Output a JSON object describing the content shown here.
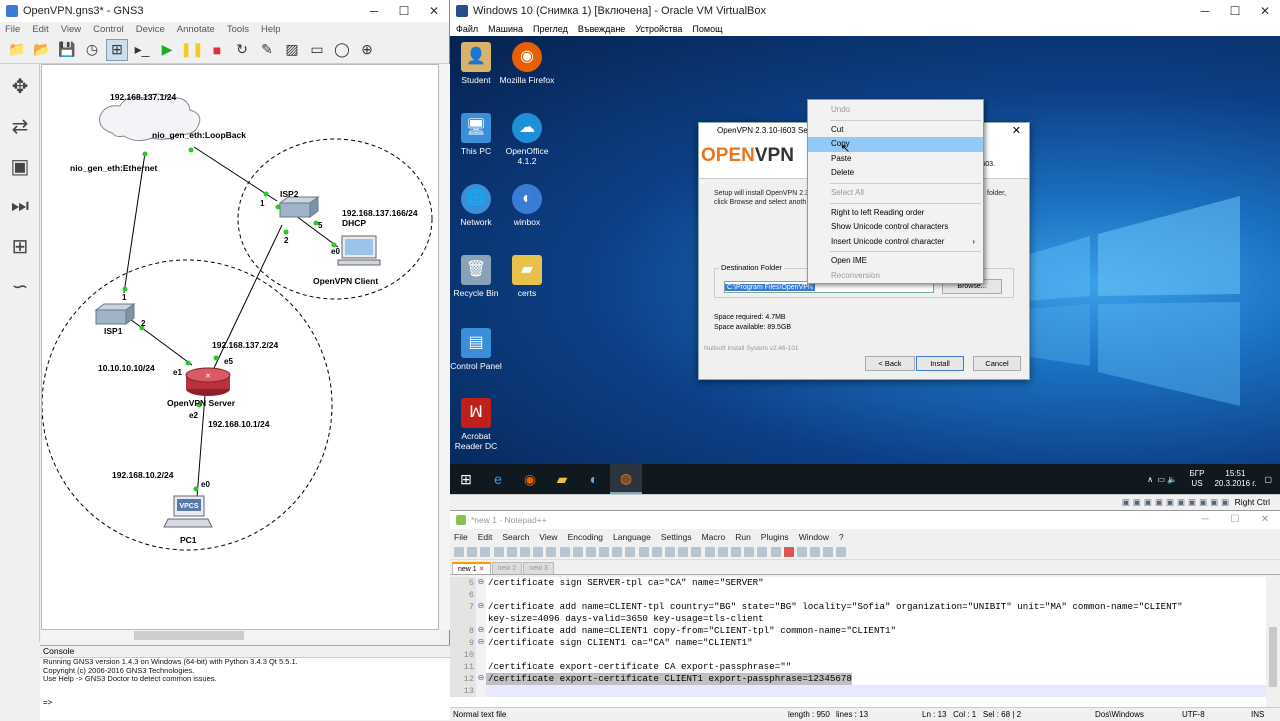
{
  "gns3": {
    "title": "OpenVPN.gns3* - GNS3",
    "menu": [
      "File",
      "Edit",
      "View",
      "Control",
      "Device",
      "Annotate",
      "Tools",
      "Help"
    ],
    "labels": {
      "cloud_net": "192.168.137.1/24",
      "loopback": "nio_gen_eth:LoopBack",
      "ethernet": "nio_gen_eth:Ethernet",
      "isp2": "ISP2",
      "isp2_dhcp_ip": "192.168.137.166/24",
      "dhcp": "DHCP",
      "client": "OpenVPN Client",
      "isp1": "ISP1",
      "srv_e5_ip": "192.168.137.2/24",
      "srv_e1_ip": "10.10.10.10/24",
      "server": "OpenVPN Server",
      "srv_e2_ip": "192.168.10.1/24",
      "pc_net": "192.168.10.2/24",
      "pc1": "PC1",
      "vpcs": "VPCS",
      "p1": "1",
      "p5": "5",
      "p2": "2",
      "e0": "e0",
      "isp1_p1": "1",
      "isp1_p2": "2",
      "e5": "e5",
      "e1": "e1",
      "e2": "e2",
      "pc_e0": "e0"
    },
    "console": {
      "title": "Console",
      "lines": [
        "Running GNS3 version 1.4.3 on Windows (64-bit) with Python 3.4.3 Qt 5.5.1.",
        "Copyright (c) 2006-2016 GNS3 Technologies.",
        "Use Help -> GNS3 Doctor to detect common issues."
      ],
      "prompt": "=>"
    }
  },
  "vbox": {
    "title": "Windows 10 (Снимка 1) [Включена] - Oracle VM VirtualBox",
    "menu": [
      "Файл",
      "Машина",
      "Преглед",
      "Въвеждане",
      "Устройства",
      "Помощ"
    ],
    "desktop_icons": [
      {
        "label": "Student",
        "icon": "user-folder-icon",
        "color": "#d9b26b"
      },
      {
        "label": "Mozilla Firefox",
        "icon": "firefox-icon",
        "color": "#e66000"
      },
      {
        "label": "This PC",
        "icon": "computer-icon",
        "color": "#3a8fd8"
      },
      {
        "label": "OpenOffice 4.1.2",
        "icon": "openoffice-icon",
        "color": "#1e90d8"
      },
      {
        "label": "Network",
        "icon": "network-icon",
        "color": "#3a8fd8"
      },
      {
        "label": "winbox",
        "icon": "winbox-icon",
        "color": "#3a7bd5"
      },
      {
        "label": "Recycle Bin",
        "icon": "recycle-bin-icon",
        "color": "#8aa2b8"
      },
      {
        "label": "certs",
        "icon": "folder-icon",
        "color": "#e8c14a"
      },
      {
        "label": "Control Panel",
        "icon": "control-panel-icon",
        "color": "#3a8fd8"
      },
      {
        "label": "Acrobat Reader DC",
        "icon": "acrobat-icon",
        "color": "#c0201a"
      }
    ],
    "setup": {
      "title": "OpenVPN 2.3.10-I603 Setup",
      "logo_open": "OPEN",
      "logo_vpn": "VPN",
      "right_text": "603.",
      "desc": "Setup will install OpenVPN 2.3",
      "desc2": "click Browse and select anoth",
      "folder_tail": "folder,",
      "dest_label": "Destination Folder",
      "dest_path": "C:\\Program Files\\OpenVPN",
      "browse": "Browse...",
      "space_required": "Space required: 4.7MB",
      "space_available": "Space available: 89.5GB",
      "nsis": "Nullsoft Install System v2.46-101",
      "back": "< Back",
      "install": "Install",
      "cancel": "Cancel"
    },
    "context_menu": [
      {
        "label": "Undo",
        "disabled": true
      },
      {
        "sep": true
      },
      {
        "label": "Cut"
      },
      {
        "label": "Copy",
        "highlight": true
      },
      {
        "label": "Paste"
      },
      {
        "label": "Delete"
      },
      {
        "sep": true
      },
      {
        "label": "Select All",
        "disabled": true
      },
      {
        "sep": true
      },
      {
        "label": "Right to left Reading order"
      },
      {
        "label": "Show Unicode control characters"
      },
      {
        "label": "Insert Unicode control character",
        "submenu": true
      },
      {
        "sep": true
      },
      {
        "label": "Open IME"
      },
      {
        "label": "Reconversion",
        "disabled": true
      }
    ],
    "tray": {
      "lang1": "БГР",
      "lang2": "US",
      "time": "15:51",
      "date": "20.3.2016 г."
    },
    "host_key": "Right Ctrl"
  },
  "npp": {
    "title": "*new 1 - Notepad++",
    "menu": [
      "File",
      "Edit",
      "Search",
      "View",
      "Encoding",
      "Language",
      "Settings",
      "Macro",
      "Run",
      "Plugins",
      "Window",
      "?"
    ],
    "tabs": [
      {
        "label": "new 1",
        "active": true
      },
      {
        "label": "new 2"
      },
      {
        "label": "new 3"
      }
    ],
    "lines": [
      {
        "n": "5",
        "fold": "⊖",
        "text": "/certificate sign SERVER-tpl ca=\"CA\" name=\"SERVER\""
      },
      {
        "n": "6",
        "fold": "",
        "text": ""
      },
      {
        "n": "7",
        "fold": "⊖",
        "text": "/certificate add name=CLIENT-tpl country=\"BG\" state=\"BG\" locality=\"Sofia\" organization=\"UNIBIT\" unit=\"MA\" common-name=\"CLIENT\""
      },
      {
        "n": "",
        "fold": "",
        "text": "key-size=4096 days-valid=3650 key-usage=tls-client"
      },
      {
        "n": "8",
        "fold": "⊖",
        "text": "/certificate add name=CLIENT1 copy-from=\"CLIENT-tpl\" common-name=\"CLIENT1\""
      },
      {
        "n": "9",
        "fold": "⊖",
        "text": "/certificate sign CLIENT1 ca=\"CA\" name=\"CLIENT1\""
      },
      {
        "n": "10",
        "fold": "",
        "text": ""
      },
      {
        "n": "11",
        "fold": "",
        "text": "/certificate export-certificate CA export-passphrase=\"\""
      },
      {
        "n": "12",
        "fold": "⊖",
        "text": "/certificate export-certificate CLIENT1 export-passphrase=12345678",
        "selected": true
      },
      {
        "n": "13",
        "fold": "",
        "text": "",
        "current": true
      }
    ],
    "status": {
      "type": "Normal text file",
      "length": "length : 950",
      "lines": "lines : 13",
      "pos": "Ln : 13   Col : 1   Sel : 68 | 2",
      "eol": "Dos\\Windows",
      "enc": "UTF-8",
      "mode": "INS"
    }
  }
}
